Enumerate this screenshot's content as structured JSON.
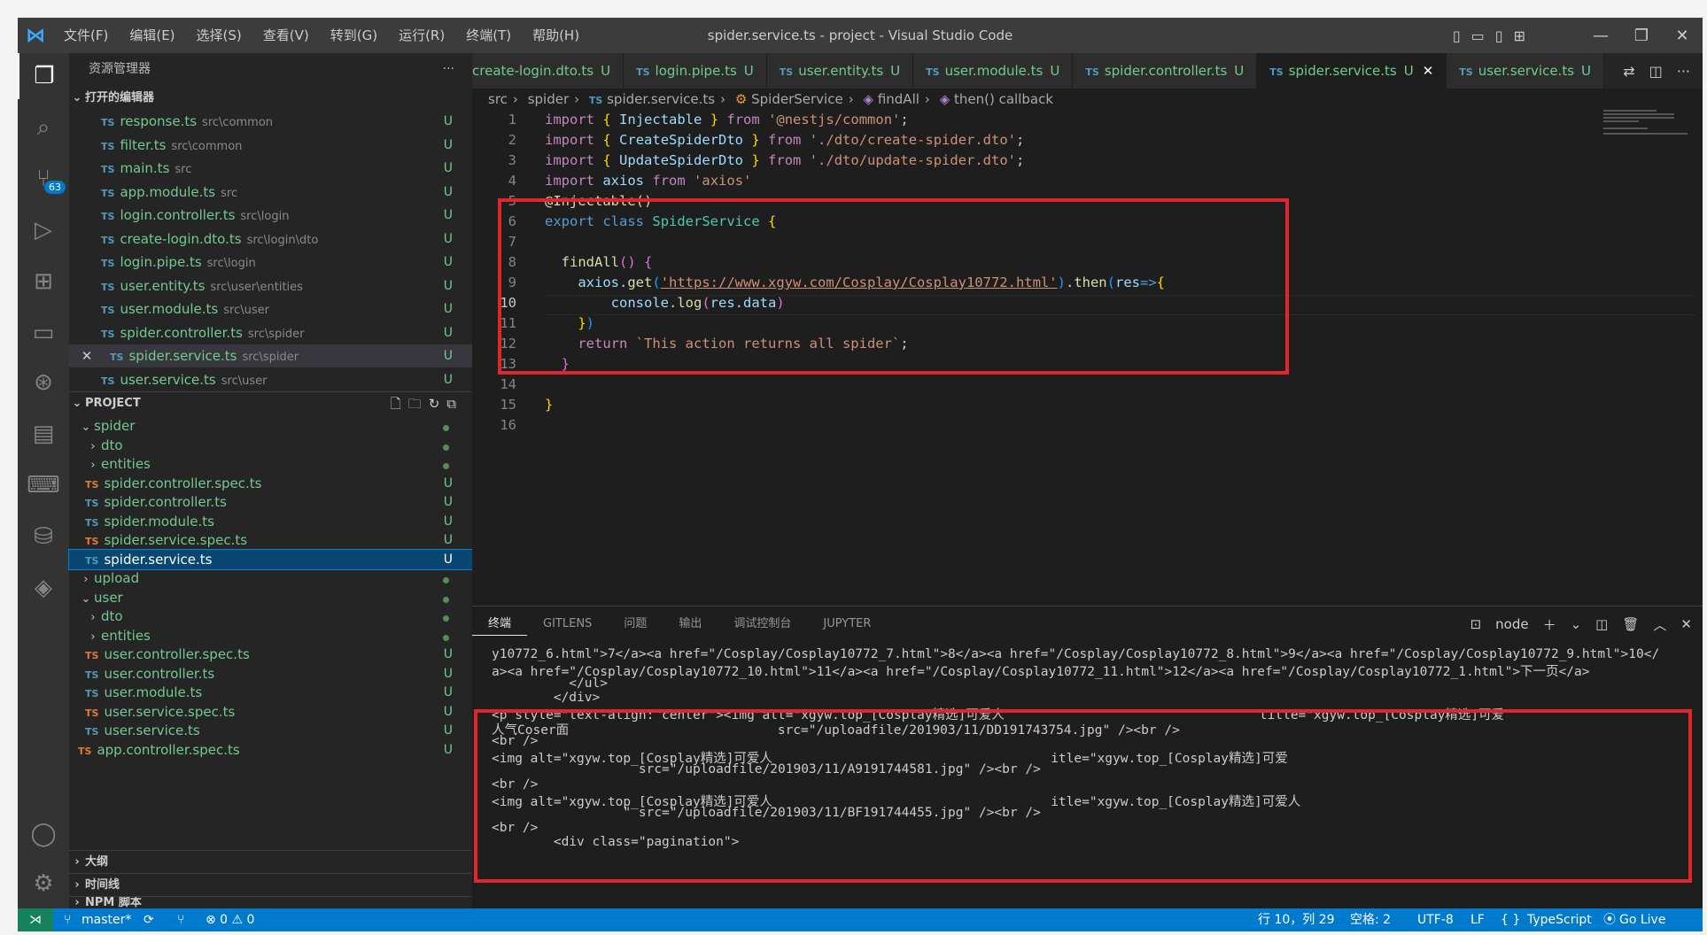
{
  "window": {
    "title": "spider.service.ts - project - Visual Studio Code",
    "menu": [
      "文件(F)",
      "编辑(E)",
      "选择(S)",
      "查看(V)",
      "转到(G)",
      "运行(R)",
      "终端(T)",
      "帮助(H)"
    ]
  },
  "activity": {
    "scm_badge": "63"
  },
  "sidebar": {
    "title": "资源管理器",
    "open_editors_title": "打开的编辑器",
    "open_editors": [
      {
        "name": "response.ts",
        "path": "src\\common",
        "status": "U"
      },
      {
        "name": "filter.ts",
        "path": "src\\common",
        "status": "U"
      },
      {
        "name": "main.ts",
        "path": "src",
        "status": "U"
      },
      {
        "name": "app.module.ts",
        "path": "src",
        "status": "U"
      },
      {
        "name": "login.controller.ts",
        "path": "src\\login",
        "status": "U"
      },
      {
        "name": "create-login.dto.ts",
        "path": "src\\login\\dto",
        "status": "U"
      },
      {
        "name": "login.pipe.ts",
        "path": "src\\login",
        "status": "U"
      },
      {
        "name": "user.entity.ts",
        "path": "src\\user\\entities",
        "status": "U"
      },
      {
        "name": "user.module.ts",
        "path": "src\\user",
        "status": "U"
      },
      {
        "name": "spider.controller.ts",
        "path": "src\\spider",
        "status": "U"
      },
      {
        "name": "spider.service.ts",
        "path": "src\\spider",
        "status": "U"
      },
      {
        "name": "user.service.ts",
        "path": "src\\user",
        "status": "U"
      }
    ],
    "project_title": "PROJECT",
    "tree": [
      {
        "name": "spider",
        "status": ""
      },
      {
        "name": "dto",
        "status": ""
      },
      {
        "name": "entities",
        "status": ""
      },
      {
        "name": "spider.controller.spec.ts",
        "status": "U"
      },
      {
        "name": "spider.controller.ts",
        "status": "U"
      },
      {
        "name": "spider.module.ts",
        "status": "U"
      },
      {
        "name": "spider.service.spec.ts",
        "status": "U"
      },
      {
        "name": "spider.service.ts",
        "status": "U"
      },
      {
        "name": "upload",
        "status": ""
      },
      {
        "name": "user",
        "status": ""
      },
      {
        "name": "dto",
        "status": ""
      },
      {
        "name": "entities",
        "status": ""
      },
      {
        "name": "user.controller.spec.ts",
        "status": "U"
      },
      {
        "name": "user.controller.ts",
        "status": "U"
      },
      {
        "name": "user.module.ts",
        "status": "U"
      },
      {
        "name": "user.service.spec.ts",
        "status": "U"
      },
      {
        "name": "user.service.ts",
        "status": "U"
      },
      {
        "name": "app.controller.spec.ts",
        "status": "U"
      }
    ],
    "outline_title": "大纲",
    "timeline_title": "时间线",
    "npm_title": "NPM 脚本"
  },
  "tabs": [
    {
      "label": "create-login.dto.ts",
      "status": "U"
    },
    {
      "label": "login.pipe.ts",
      "status": "U"
    },
    {
      "label": "user.entity.ts",
      "status": "U"
    },
    {
      "label": "user.module.ts",
      "status": "U"
    },
    {
      "label": "spider.controller.ts",
      "status": "U"
    },
    {
      "label": "spider.service.ts",
      "status": "U"
    },
    {
      "label": "user.service.ts",
      "status": "U"
    }
  ],
  "breadcrumbs": [
    "src",
    "spider",
    "spider.service.ts",
    "SpiderService",
    "findAll",
    "then() callback"
  ],
  "code": {
    "line_numbers": [
      "1",
      "2",
      "3",
      "4",
      "5",
      "6",
      "7",
      "8",
      "9",
      "10",
      "11",
      "12",
      "13",
      "14",
      "15",
      "16"
    ],
    "l1": "import { Injectable } from '@nestjs/common';",
    "l2": "import { CreateSpiderDto } from './dto/create-spider.dto';",
    "l3": "import { UpdateSpiderDto } from './dto/update-spider.dto';",
    "l4": "import axios from 'axios'",
    "l5": "@Injectable()",
    "l6": "export class SpiderService {",
    "l8": "findAll() {",
    "l9a": "axios.get(",
    "l9b": "'https://www.xgyw.com/Cosplay/Cosplay10772.html'",
    "l9c": ").then(res=>{",
    "l10": "console.log(res.data)",
    "l11": "})",
    "l12": "return `This action returns all spider`;",
    "l13": "}",
    "l15": "}"
  },
  "panel": {
    "tabs": [
      "终端",
      "GITLENS",
      "问题",
      "输出",
      "调试控制台",
      "JUPYTER"
    ],
    "shell": "node",
    "lines": [
      "y10772_6.html\">7</a><a href=\"/Cosplay/Cosplay10772_7.html\">8</a><a href=\"/Cosplay/Cosplay10772_8.html\">9</a><a href=\"/Cosplay/Cosplay10772_9.html\">10</",
      "a><a href=\"/Cosplay/Cosplay10772_10.html\">11</a><a href=\"/Cosplay/Cosplay10772_11.html\">12</a><a href=\"/Cosplay/Cosplay10772_1.html\">下一页</a>",
      "          </ul>",
      "        </div>",
      "<p style=\"text-align: center\"><img alt=\"xgyw.top_[Cosplay精选]可爱人                                 title=\"xgyw.top_[Cosplay精选]可爱",
      "人气Coser面                           src=\"/uploadfile/201903/11/DD191743754.jpg\" /><br />",
      "<br />",
      "<img alt=\"xgyw.top_[Cosplay精选]可爱人                                    itle=\"xgyw.top_[Cosplay精选]可爱",
      "                   src=\"/uploadfile/201903/11/A9191744581.jpg\" /><br />",
      "<br />",
      "<img alt=\"xgyw.top_[Cosplay精选]可爱人                                    itle=\"xgyw.top_[Cosplay精选]可爱人",
      "                 \" src=\"/uploadfile/201903/11/BF191744455.jpg\" /><br />",
      "<br />",
      "        <div class=\"pagination\">"
    ]
  },
  "status": {
    "branch": "master*",
    "problems": "⊗ 0 ⚠ 0",
    "position": "行 10，列 29",
    "spaces": "空格: 2",
    "encoding": "UTF-8",
    "eol": "LF",
    "language": "TypeScript",
    "golive": "Go Live"
  }
}
